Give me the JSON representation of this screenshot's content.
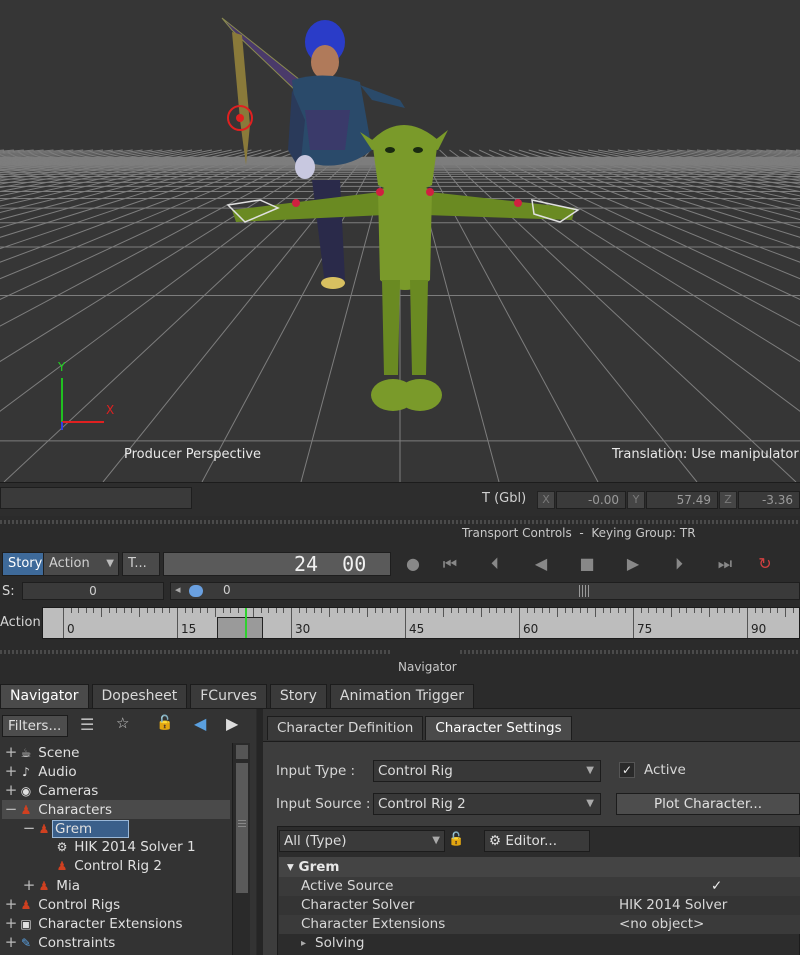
{
  "viewport": {
    "camera_label": "Producer Perspective",
    "mode_label": "Translation: Use manipulator",
    "axis_y": "Y",
    "axis_x": "X"
  },
  "coords": {
    "label": "T (Gbl)",
    "x_tag": "X",
    "x_value": "-0.00",
    "y_tag": "Y",
    "y_value": "57.49",
    "z_tag": "Z",
    "z_value": "-3.36"
  },
  "transport": {
    "header": "Transport Controls  -  Keying Group: TR",
    "story_button": "Story",
    "action_dropdown": "Action",
    "t_dropdown": "T...",
    "frame_display": "24  00",
    "s_label": "S:",
    "s_value": "0",
    "offset_value": "0"
  },
  "timeline": {
    "track_label": "Action",
    "ticks": [
      "0",
      "15",
      "30",
      "45",
      "60",
      "75",
      "90"
    ],
    "current_frame": 24
  },
  "navigator_header": "Navigator",
  "tabs": [
    {
      "label": "Navigator",
      "active": true
    },
    {
      "label": "Dopesheet",
      "active": false
    },
    {
      "label": "FCurves",
      "active": false
    },
    {
      "label": "Story",
      "active": false
    },
    {
      "label": "Animation Trigger",
      "active": false
    }
  ],
  "tree": {
    "filters_button": "Filters...",
    "items": [
      {
        "label": "Scene",
        "icon": "teapot-icon"
      },
      {
        "label": "Audio",
        "icon": "audio-icon"
      },
      {
        "label": "Cameras",
        "icon": "camera-icon"
      },
      {
        "label": "Characters",
        "icon": "character-icon"
      },
      {
        "label": "Grem",
        "icon": "character-icon"
      },
      {
        "label": "HIK 2014 Solver 1",
        "icon": "gear-icon"
      },
      {
        "label": "Control Rig 2",
        "icon": "character-icon"
      },
      {
        "label": "Mia",
        "icon": "character-icon"
      },
      {
        "label": "Control Rigs",
        "icon": "rig-icon"
      },
      {
        "label": "Character Extensions",
        "icon": "extension-icon"
      },
      {
        "label": "Constraints",
        "icon": "constraint-icon"
      }
    ]
  },
  "char_tabs": [
    {
      "label": "Character Definition",
      "active": false
    },
    {
      "label": "Character Settings",
      "active": true
    }
  ],
  "settings": {
    "input_type_label": "Input Type :",
    "input_type_value": "Control Rig",
    "active_label": "Active",
    "active_checked": true,
    "input_source_label": "Input Source :",
    "input_source_value": "Control Rig 2",
    "plot_button": "Plot Character...",
    "filter_value": "All (Type)",
    "editor_button": "Editor...",
    "group_title": "Grem",
    "props": [
      {
        "name": "Active Source",
        "value": "✓"
      },
      {
        "name": "Character Solver",
        "value": "HIK 2014 Solver"
      },
      {
        "name": "Character Extensions",
        "value": "<no object>"
      }
    ],
    "subgroup": "Solving"
  },
  "colors": {
    "accent": "#3e6a9a",
    "selection": "#5a7fa8",
    "timeline_bg": "#bdbdbd",
    "cursor": "#2fd12f"
  }
}
